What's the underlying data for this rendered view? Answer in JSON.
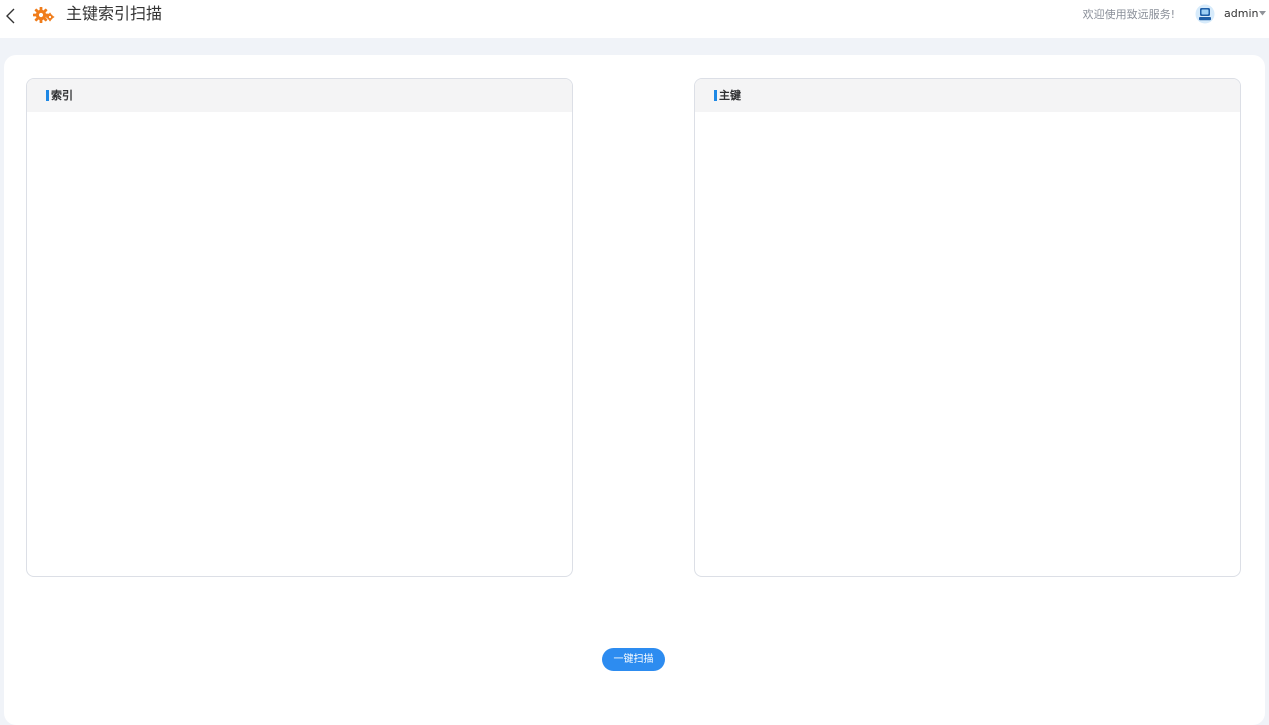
{
  "header": {
    "title": "主键索引扫描",
    "back_icon": "chevron-left-icon",
    "app_icon": "gears-icon",
    "welcome_text": "欢迎使用致远服务!",
    "username": "admin",
    "avatar_icon": "user-avatar-icon",
    "menu_icon": "caret-down-icon"
  },
  "panels": {
    "index": {
      "title": "索引"
    },
    "primary_key": {
      "title": "主键"
    }
  },
  "actions": {
    "scan_label": "一键扫描"
  },
  "colors": {
    "accent": "#2d8cf0",
    "app_icon": "#f07c1a",
    "panel_header_bg": "#f4f4f5",
    "page_bg": "#f0f3f8"
  }
}
